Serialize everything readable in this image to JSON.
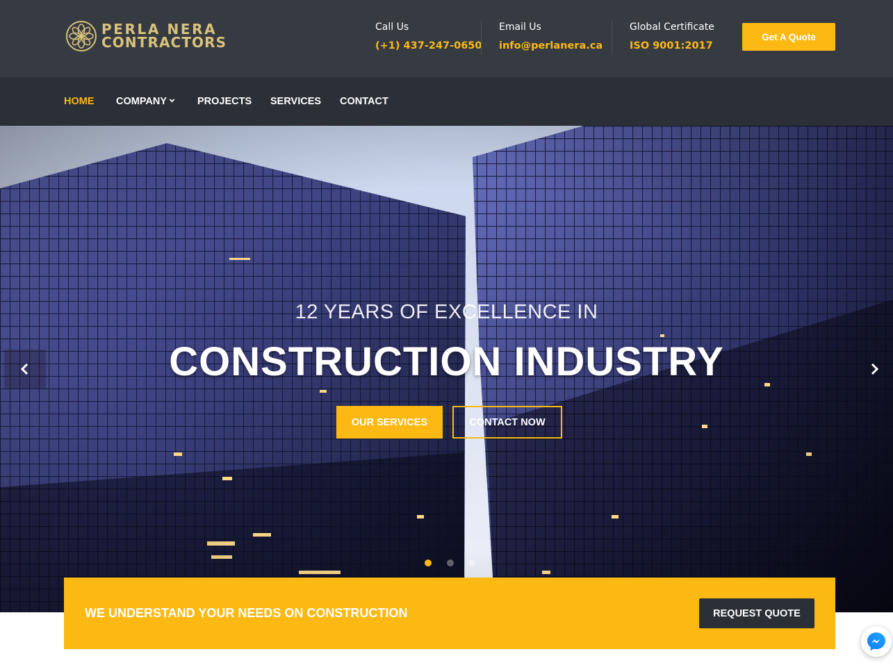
{
  "brand": {
    "line1": "PERLA NERA",
    "line2": "CONTRACTORS"
  },
  "header": {
    "call": {
      "label": "Call Us",
      "value": "(+1) 437-247-0650"
    },
    "email": {
      "label": "Email Us",
      "value": "info@perlanera.ca"
    },
    "cert": {
      "label": "Global Certificate",
      "value": "ISO 9001:2017"
    },
    "quote_button": "Get A Quote"
  },
  "nav": {
    "home": "HOME",
    "company": "COMPANY",
    "projects": "PROJECTS",
    "services": "SERVICES",
    "contact": "CONTACT"
  },
  "hero": {
    "subtitle": "12 YEARS OF EXCELLENCE IN",
    "title": "CONSTRUCTION INDUSTRY",
    "btn_services": "OUR SERVICES",
    "btn_contact": "CONTACT NOW",
    "slides_total": 3,
    "active_slide": 1
  },
  "cta": {
    "text": "WE UNDERSTAND YOUR NEEDS ON CONSTRUCTION",
    "button": "REQUEST QUOTE"
  },
  "colors": {
    "accent": "#fdb913",
    "topbar": "#363b42",
    "nav": "#2b2f36",
    "logo_gold": "#d9c27a"
  },
  "icons": {
    "logo": "flower-logo-icon",
    "caret": "chevron-down-icon",
    "prev": "chevron-left-icon",
    "next": "chevron-right-icon",
    "chat": "messenger-icon"
  }
}
